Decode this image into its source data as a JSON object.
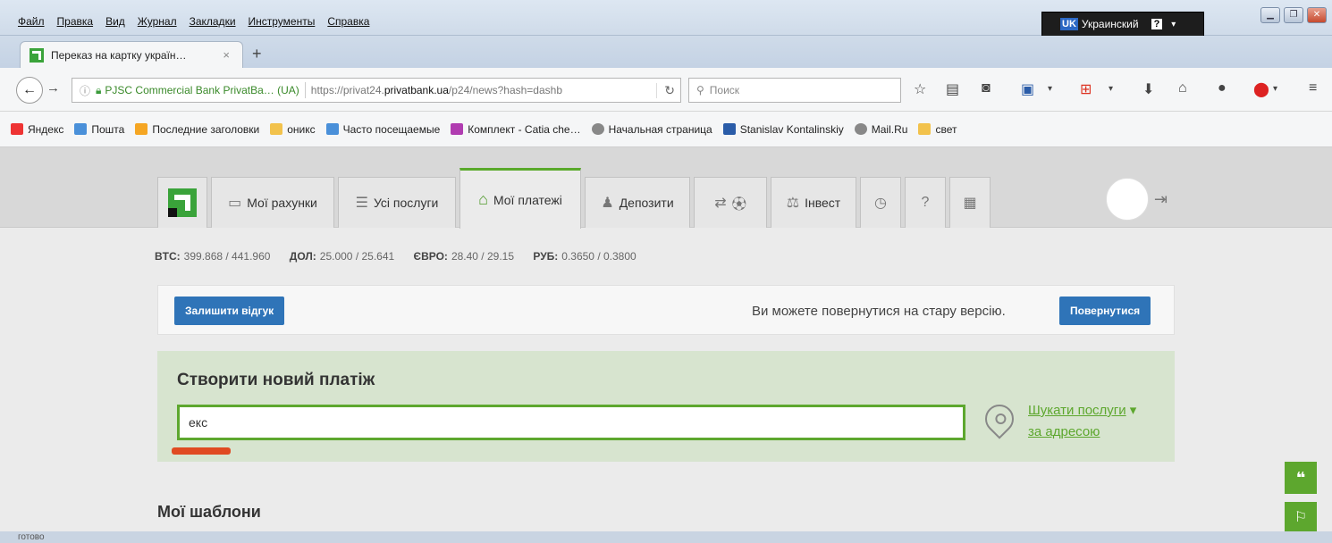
{
  "menubar": {
    "items": [
      "Файл",
      "Правка",
      "Вид",
      "Журнал",
      "Закладки",
      "Инструменты",
      "Справка"
    ],
    "lang_code": "UK",
    "lang_name": "Украинский",
    "help_label": "?"
  },
  "tab": {
    "title": "Переказ на картку україн…",
    "close": "×",
    "new_tab": "+"
  },
  "urlbar": {
    "identity": "PJSC Commercial Bank PrivatBa… (UA)",
    "url_prefix": "https://privat24.",
    "url_domain": "privatbank.ua",
    "url_suffix": "/p24/news?hash=dashb"
  },
  "searchbar": {
    "placeholder": "Поиск"
  },
  "bookmarks": [
    {
      "label": "Яндекс",
      "color": "#e33"
    },
    {
      "label": "Пошта",
      "color": "#4a90d9"
    },
    {
      "label": "Последние заголовки",
      "color": "#f5a623"
    },
    {
      "label": "оникс",
      "color": "#f2c24c"
    },
    {
      "label": "Часто посещаемые",
      "color": "#4a90d9"
    },
    {
      "label": "Комплект - Catia che…",
      "color": "#b03cb0"
    },
    {
      "label": "Начальная страница",
      "color": "#888"
    },
    {
      "label": "Stanislav Kontalinskiy",
      "color": "#2a5ca8"
    },
    {
      "label": "Mail.Ru",
      "color": "#888"
    },
    {
      "label": "свет",
      "color": "#f2c24c"
    }
  ],
  "nav": {
    "accounts": "Мої рахунки",
    "services": "Усі послуги",
    "payments": "Мої платежі",
    "deposits": "Депозити",
    "invest": "Інвест"
  },
  "rates": {
    "btc_label": "BTC:",
    "btc_value": "399.868 / 441.960",
    "usd_label": "ДОЛ:",
    "usd_value": "25.000 / 25.641",
    "eur_label": "ЄВРО:",
    "eur_value": "28.40 / 29.15",
    "rub_label": "РУБ:",
    "rub_value": "0.3650 / 0.3800"
  },
  "feedback": {
    "leave_feedback": "Залишити відгук",
    "old_version_text": "Ви можете повернутися на стару версію.",
    "return_button": "Повернутися"
  },
  "new_payment": {
    "title": "Створити новий платіж",
    "input_value": "екс",
    "search_services": "Шукати послуги",
    "by_address": "за адресою"
  },
  "templates": {
    "title": "Мої шаблони"
  },
  "status": {
    "text": "готово"
  },
  "colors": {
    "brand_green": "#5da72e",
    "button_blue": "#2f74b8",
    "panel_green": "#d7e4cf"
  }
}
